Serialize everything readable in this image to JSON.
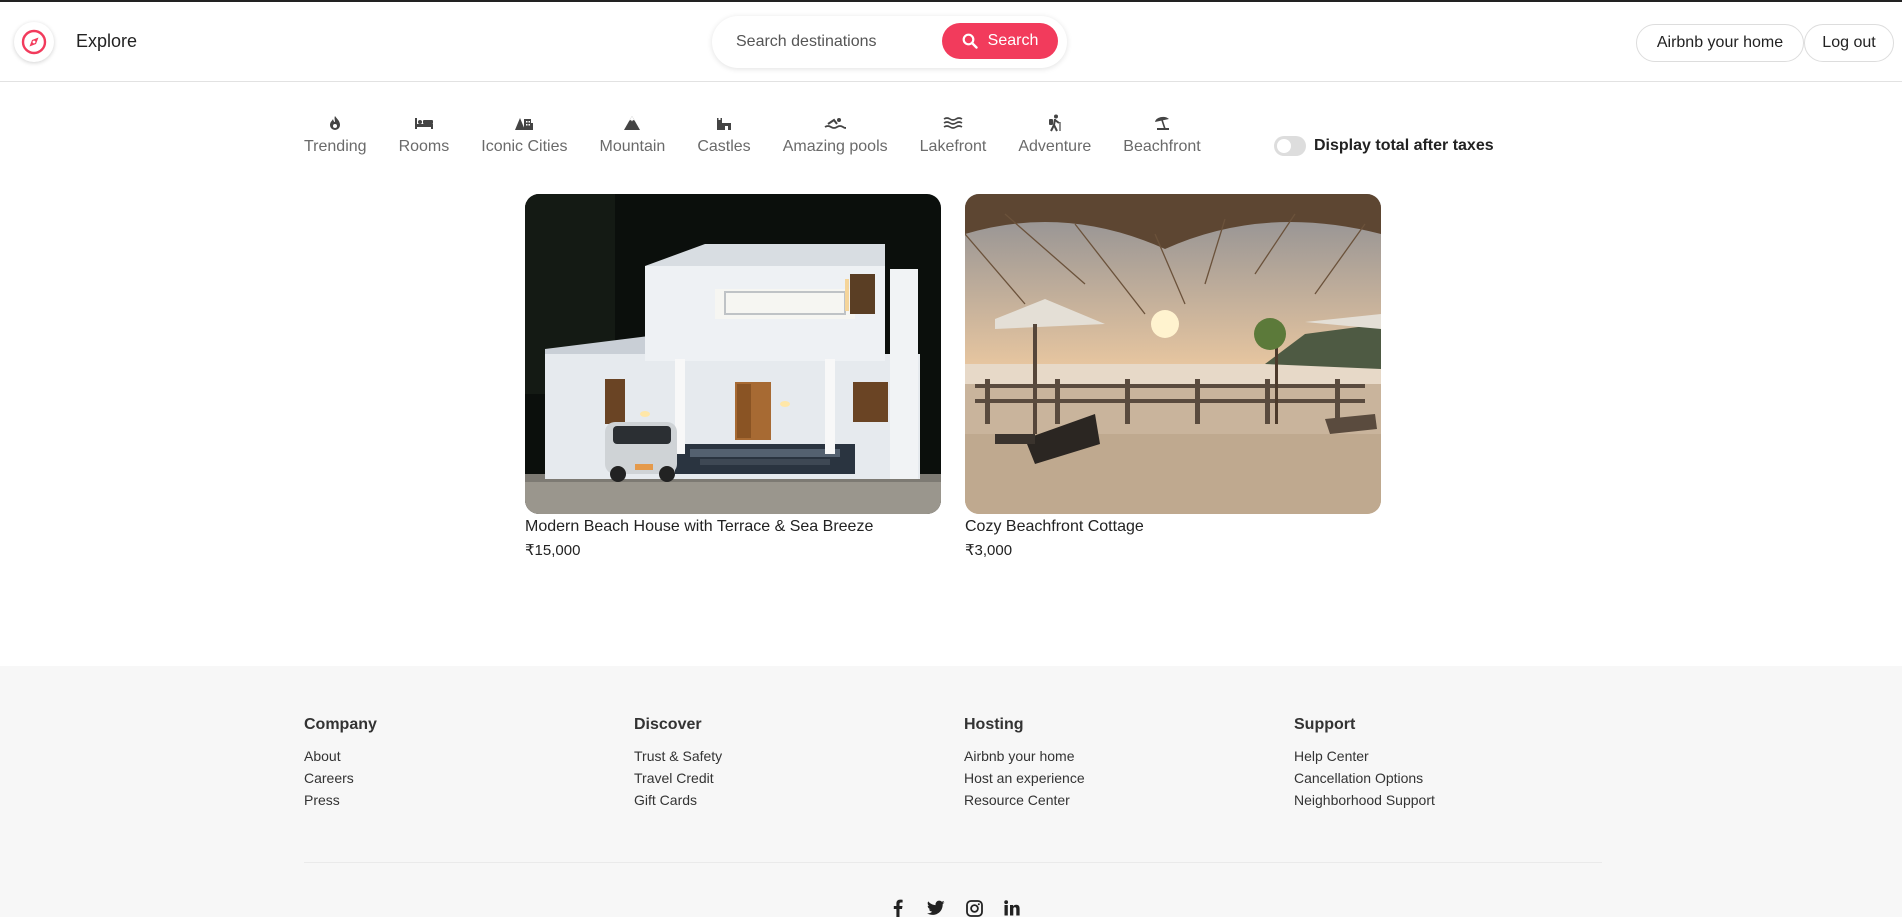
{
  "header": {
    "brand": "Explore",
    "search_placeholder": "Search destinations",
    "search_button": "Search",
    "airbnb_home_button": "Airbnb your home",
    "logout_button": "Log out",
    "accent_color": "#f23b5c"
  },
  "categories": [
    {
      "label": "Trending",
      "icon": "fire-icon"
    },
    {
      "label": "Rooms",
      "icon": "bed-icon"
    },
    {
      "label": "Iconic Cities",
      "icon": "city-icon"
    },
    {
      "label": "Mountain",
      "icon": "mountain-icon"
    },
    {
      "label": "Castles",
      "icon": "castle-icon"
    },
    {
      "label": "Amazing pools",
      "icon": "swimmer-icon"
    },
    {
      "label": "Lakefront",
      "icon": "water-icon"
    },
    {
      "label": "Adventure",
      "icon": "hiker-icon"
    },
    {
      "label": "Beachfront",
      "icon": "umbrella-beach-icon"
    }
  ],
  "toggle": {
    "label": "Display total after taxes",
    "on": false
  },
  "listings": [
    {
      "title": "Modern Beach House with Terrace & Sea Breeze",
      "price": "₹15,000"
    },
    {
      "title": "Cozy Beachfront Cottage",
      "price": "₹3,000"
    }
  ],
  "footer": {
    "columns": [
      {
        "heading": "Company",
        "links": [
          "About",
          "Careers",
          "Press"
        ]
      },
      {
        "heading": "Discover",
        "links": [
          "Trust & Safety",
          "Travel Credit",
          "Gift Cards"
        ]
      },
      {
        "heading": "Hosting",
        "links": [
          "Airbnb your home",
          "Host an experience",
          "Resource Center"
        ]
      },
      {
        "heading": "Support",
        "links": [
          "Help Center",
          "Cancellation Options",
          "Neighborhood Support"
        ]
      }
    ],
    "social": [
      "facebook-icon",
      "twitter-icon",
      "instagram-icon",
      "linkedin-icon"
    ]
  }
}
